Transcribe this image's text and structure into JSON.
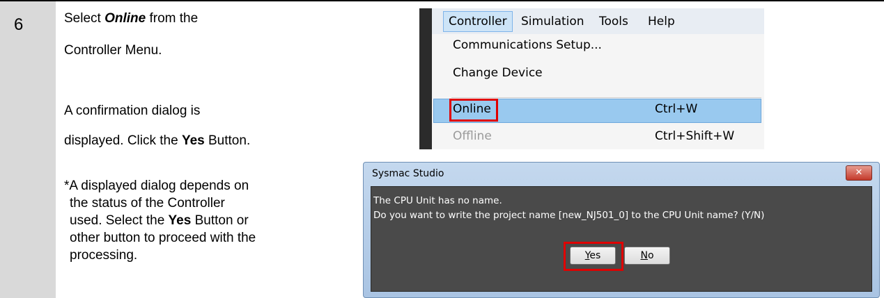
{
  "step": {
    "number": "6"
  },
  "instructions": {
    "line1_pre": "Select ",
    "line1_em": "Online",
    "line1_post": " from the",
    "line2": "Controller Menu.",
    "line3": "A confirmation dialog is",
    "line4_pre": "displayed. Click the ",
    "line4_b": "Yes",
    "line4_post": " Button.",
    "note1": "*A displayed dialog depends on",
    "note2": "the status of the Controller",
    "note3_pre": "used. Select the ",
    "note3_b": "Yes",
    "note3_post": " Button or",
    "note4": "other button to proceed with the",
    "note5": "processing."
  },
  "menu": {
    "bar": [
      "Controller",
      "Simulation",
      "Tools",
      "Help"
    ],
    "items": [
      {
        "label": "Communications Setup...",
        "shortcut": ""
      },
      {
        "label": "Change Device",
        "shortcut": ""
      },
      {
        "label": "Online",
        "shortcut": "Ctrl+W"
      },
      {
        "label": "Offline",
        "shortcut": "Ctrl+Shift+W"
      }
    ]
  },
  "dialog": {
    "title": "Sysmac Studio",
    "close_label": "✕",
    "message1": "The CPU Unit has no name.",
    "message2": "Do you want to write the project name [new_NJ501_0] to the CPU Unit name? (Y/N)",
    "yes_accel": "Y",
    "yes_rest": "es",
    "no_accel": "N",
    "no_rest": "o"
  },
  "colors": {
    "highlight": "#99c9ef",
    "callout": "#e00000"
  }
}
